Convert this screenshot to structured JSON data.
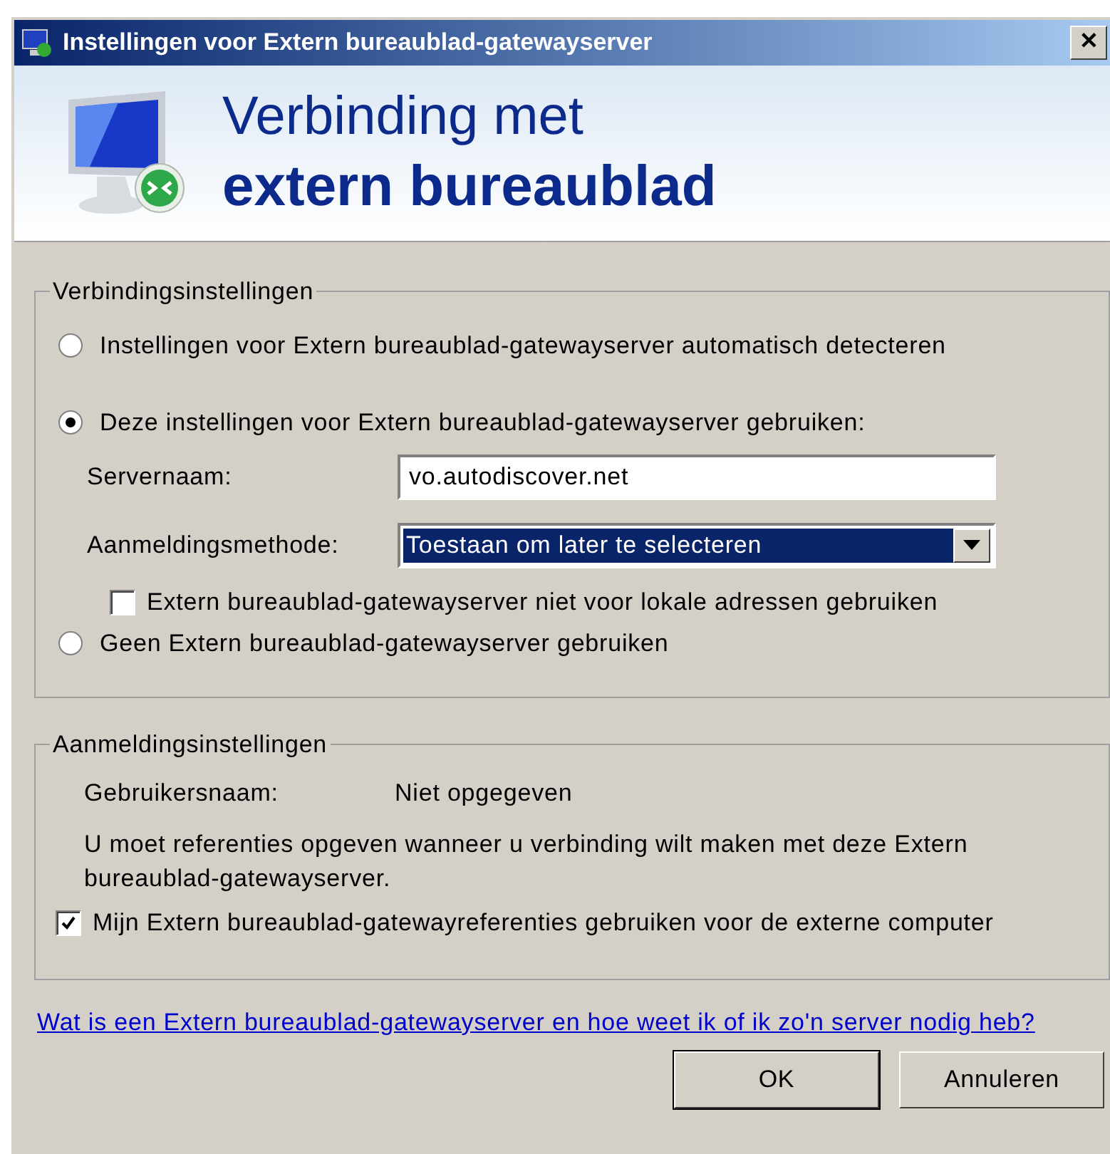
{
  "window": {
    "title": "Instellingen voor Extern bureaublad-gatewayserver",
    "close": "✕"
  },
  "header": {
    "line1": "Verbinding met",
    "line2": "extern bureaublad"
  },
  "connection_settings": {
    "title": "Verbindingsinstellingen",
    "rows": [
      {
        "kind": "radio",
        "label": "Instellingen voor Extern bureaublad-gatewayserver automatisch detecteren",
        "selected": false
      },
      {
        "kind": "radio",
        "label": "Deze instellingen voor Extern bureaublad-gatewayserver gebruiken:",
        "selected": true
      },
      {
        "kind": "field",
        "label": "Servernaam:",
        "value": "vo.autodiscover.net"
      },
      {
        "kind": "dropdown",
        "label": "Aanmeldingsmethode:",
        "value": "Toestaan om later te selecteren"
      },
      {
        "kind": "checkbox",
        "label": "Extern bureaublad-gatewayserver niet voor lokale adressen gebruiken",
        "checked": false
      },
      {
        "kind": "radio",
        "label": "Geen Extern bureaublad-gatewayserver gebruiken",
        "selected": false
      }
    ]
  },
  "logon_settings": {
    "title": "Aanmeldingsinstellingen",
    "username_label": "Gebruikersnaam:",
    "username_value": "Niet opgegeven",
    "message": "U moet referenties opgeven wanneer u verbinding wilt maken met deze Extern bureaublad-gatewayserver.",
    "checkbox": {
      "label": "Mijn Extern bureaublad-gatewayreferenties gebruiken voor de externe computer",
      "checked": true
    }
  },
  "help_link": "Wat is een Extern bureaublad-gatewayserver en hoe weet ik of ik zo'n server nodig heb?",
  "buttons": [
    {
      "label": "OK",
      "default": true
    },
    {
      "label": "Annuleren",
      "default": false
    }
  ]
}
